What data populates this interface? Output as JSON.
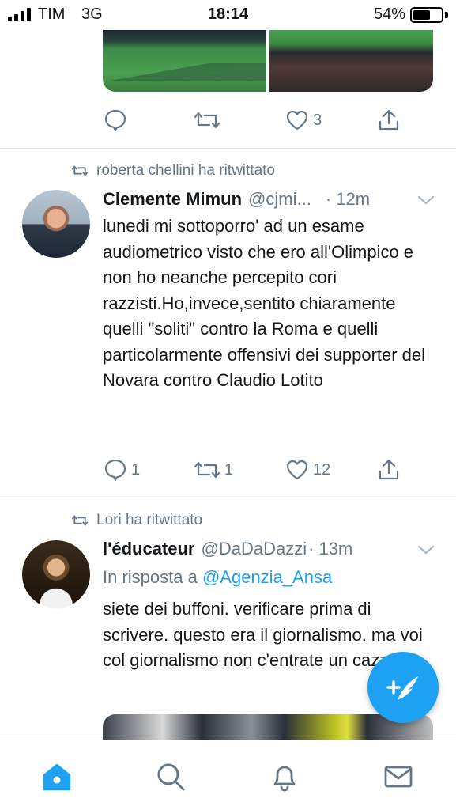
{
  "status_bar": {
    "carrier": "TIM",
    "network": "3G",
    "time": "18:14",
    "battery": "54%"
  },
  "tweets": [
    {
      "actions": {
        "reply": "",
        "retweet": "",
        "like": "3"
      }
    },
    {
      "retweeted_by": "roberta chellini ha ritwittato",
      "name": "Clemente Mimun",
      "handle": "@cjmi...",
      "time": "· 12m",
      "text": "lunedi mi sottoporro' ad un esame audiometrico visto che ero all'Olimpico e non ho neanche percepito cori razzisti.Ho,invece,sentito chiaramente quelli \"soliti\" contro la Roma e quelli particolarmente offensivi dei  supporter del Novara contro Claudio Lotito",
      "actions": {
        "reply": "1",
        "retweet": "1",
        "like": "12"
      }
    },
    {
      "retweeted_by": "Lori ha ritwittato",
      "name": "l'éducateur",
      "handle": "@DaDaDazzi",
      "time": "· 13m",
      "reply_prefix": "In risposta a",
      "reply_to": "@Agenzia_Ansa",
      "text": "siete dei buffoni. verificare prima di scrivere. questo era il giornalismo. ma voi col giornalismo non c'entrate un cazzo."
    }
  ],
  "icons": {
    "reply": "reply-icon",
    "retweet": "retweet-icon",
    "like": "heart-icon",
    "share": "share-icon",
    "compose": "compose-tweet-icon",
    "home": "home-icon",
    "search": "search-icon",
    "notifications": "bell-icon",
    "messages": "mail-icon"
  },
  "colors": {
    "accent": "#1da1f2",
    "muted": "#657786",
    "text": "#14171a"
  }
}
